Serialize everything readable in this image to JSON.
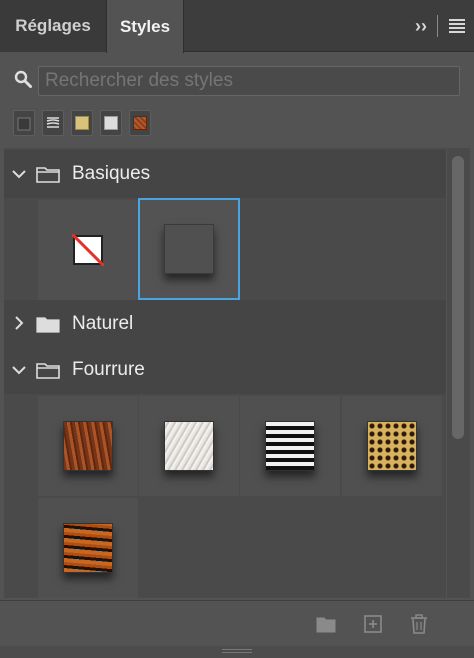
{
  "tabs": [
    {
      "label": "Réglages",
      "active": false
    },
    {
      "label": "Styles",
      "active": true
    }
  ],
  "header_icons": [
    "expand-panels-icon",
    "panel-menu-icon"
  ],
  "search": {
    "placeholder": "Rechercher des styles",
    "value": ""
  },
  "filters": [
    "layer-style-icon",
    "gradient-style-icon",
    "color-overlay-icon",
    "texture-style-icon",
    "pattern-style-icon"
  ],
  "groups": [
    {
      "name": "Basiques",
      "expanded": true,
      "items": [
        "no-style",
        "drop-shadow"
      ]
    },
    {
      "name": "Naturel",
      "expanded": false,
      "items": []
    },
    {
      "name": "Fourrure",
      "expanded": true,
      "items": [
        "brown-fur",
        "white-fur",
        "zebra-fur",
        "leopard-fur",
        "tiger-fur"
      ]
    }
  ],
  "footer_icons": [
    "new-group-icon",
    "new-style-icon",
    "delete-icon"
  ],
  "colors": {
    "accent": "#4aa3e3",
    "panel": "#535353",
    "tabbar": "#3d3d3d"
  }
}
